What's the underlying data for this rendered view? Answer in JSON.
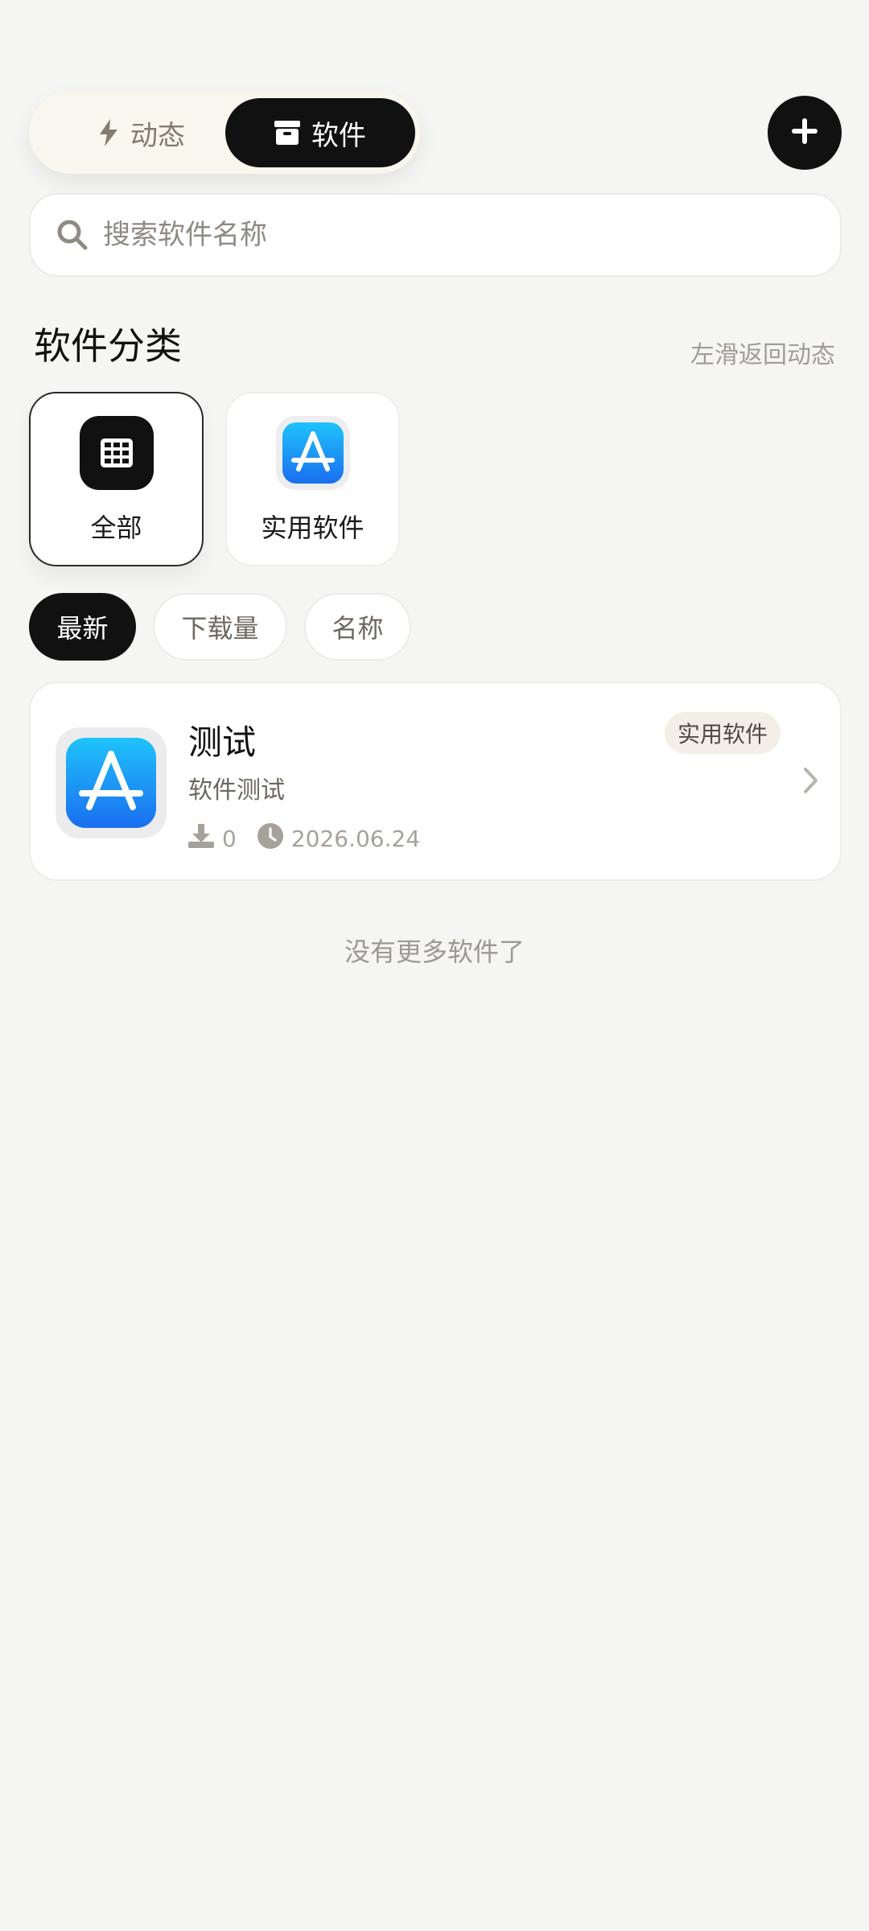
{
  "header": {
    "tabs": [
      {
        "label": "动态",
        "icon": "lightning-icon",
        "active": false
      },
      {
        "label": "软件",
        "icon": "archive-box-icon",
        "active": true
      }
    ],
    "add_icon": "plus-icon"
  },
  "search": {
    "placeholder": "搜索软件名称",
    "value": ""
  },
  "categories_section": {
    "title": "软件分类",
    "hint": "左滑返回动态",
    "items": [
      {
        "label": "全部",
        "icon": "grid-icon",
        "selected": true
      },
      {
        "label": "实用软件",
        "icon": "app-store-icon",
        "selected": false
      }
    ]
  },
  "sort": {
    "options": [
      {
        "label": "最新",
        "active": true
      },
      {
        "label": "下载量",
        "active": false
      },
      {
        "label": "名称",
        "active": false
      }
    ]
  },
  "apps": [
    {
      "name": "测试",
      "category_tag": "实用软件",
      "description": "软件测试",
      "downloads": "0",
      "date": "2026.06.24",
      "icon": "app-store-icon"
    }
  ],
  "list_end_text": "没有更多软件了",
  "colors": {
    "background": "#f5f5f3",
    "primary_dark": "#111111",
    "tag_background": "#f4efe6",
    "app_icon_blue": "#1c8cf5"
  }
}
